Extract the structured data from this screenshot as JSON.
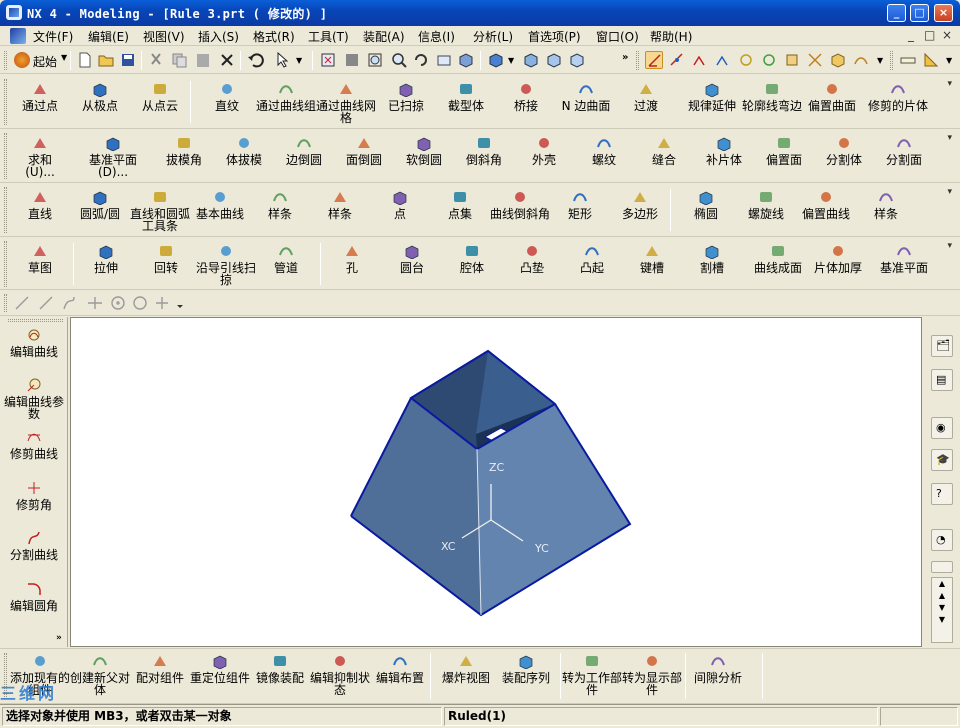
{
  "window": {
    "title": "NX 4 - Modeling - [Rule 3.prt ( 修改的) ]",
    "minimize": "_",
    "maximize": "□",
    "close": "×"
  },
  "menubar": {
    "items": [
      "文件(F)",
      "编辑(E)",
      "视图(V)",
      "插入(S)",
      "格式(R)",
      "工具(T)",
      "装配(A)",
      "信息(I)",
      "分析(L)",
      "首选项(P)",
      "窗口(O)",
      "帮助(H)"
    ],
    "mdi_controls": [
      "_",
      "□",
      "×"
    ]
  },
  "stdbar": {
    "start_label": "起始",
    "icons": [
      "new-icon",
      "open-icon",
      "save-icon",
      "cut-icon",
      "copy-icon",
      "paste-icon",
      "delete-icon",
      "undo-icon",
      "select-icon",
      "fit-icon",
      "zoom-window-icon",
      "zoom-icon",
      "rotate-icon",
      "pan-icon",
      "shade-icon",
      "cube-view-icon",
      "iso-view-icon",
      "top-view-icon",
      "snap-icon"
    ]
  },
  "row1": [
    "通过点",
    "从极点",
    "从点云",
    "直纹",
    "通过曲线组",
    "通过曲线网格",
    "已扫掠",
    "截型体",
    "桥接",
    "N 边曲面",
    "过渡",
    "规律延伸",
    "轮廓线弯边",
    "偏置曲面",
    "修剪的片体"
  ],
  "row2": [
    "求和\n(U)...",
    "基准平面\n(D)...",
    "拔模角",
    "体拔模",
    "边倒圆",
    "面倒圆",
    "软倒圆",
    "倒斜角",
    "外壳",
    "螺纹",
    "缝合",
    "补片体",
    "偏置面",
    "分割体",
    "分割面"
  ],
  "row3": [
    "直线",
    "圆弧/圆",
    "直线和圆弧工具条",
    "基本曲线",
    "样条",
    "样条",
    "点",
    "点集",
    "曲线倒斜角",
    "矩形",
    "多边形",
    "椭圆",
    "螺旋线",
    "偏置曲线",
    "样条"
  ],
  "row4": [
    "草图",
    "拉伸",
    "回转",
    "沿导引线扫掠",
    "管道",
    "孔",
    "圆台",
    "腔体",
    "凸垫",
    "凸起",
    "键槽",
    "割槽",
    "曲线成面",
    "片体加厚",
    "基准平面"
  ],
  "leftpanel": [
    "编辑曲线",
    "编辑曲线参数",
    "修剪曲线",
    "修剪角",
    "分割曲线",
    "编辑圆角"
  ],
  "viewport": {
    "axis_labels": {
      "z": "ZC",
      "x": "XC",
      "y": "YC"
    }
  },
  "bottombar": [
    "添加现有的组件",
    "创建新父对体",
    "配对组件",
    "重定位组件",
    "镜像装配",
    "编辑抑制状态",
    "编辑布置",
    "爆炸视图",
    "装配序列",
    "转为工作部件",
    "转为显示部件",
    "间隙分析"
  ],
  "status": {
    "prompt": "选择对象并使用 MB3，或者双击某一对象",
    "info": "Ruled(1)"
  },
  "watermark": "三维网",
  "colors": {
    "title_bar": "#0846b8",
    "chrome": "#ece9d8",
    "solid_face": "#5a7ea8",
    "solid_edge": "#0a1aa0"
  }
}
